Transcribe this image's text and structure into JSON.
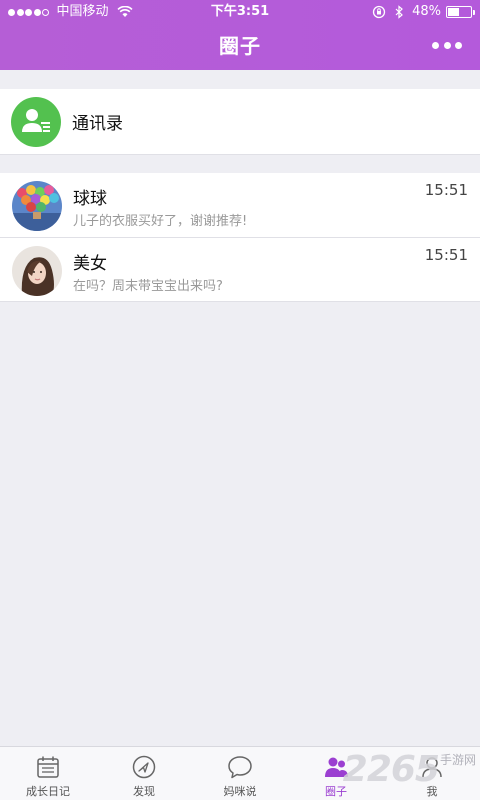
{
  "status_bar": {
    "carrier": "中国移动",
    "time": "下午3:51",
    "battery": "48%",
    "battery_level": 0.48
  },
  "nav": {
    "title": "圈子",
    "more_icon": "more-dots-icon"
  },
  "contacts": {
    "label": "通讯录",
    "icon": "contacts-icon",
    "icon_color": "#53c14f"
  },
  "chats": [
    {
      "name": "球球",
      "message": "儿子的衣服买好了，谢谢推荐!",
      "time": "15:51",
      "avatar": "balloons-avatar"
    },
    {
      "name": "美女",
      "message": "在吗？周末带宝宝出来吗?",
      "time": "15:51",
      "avatar": "woman-avatar"
    }
  ],
  "tabs": [
    {
      "label": "成长日记",
      "icon": "calendar-icon",
      "active": false
    },
    {
      "label": "发现",
      "icon": "compass-icon",
      "active": false
    },
    {
      "label": "妈咪说",
      "icon": "chat-bubble-icon",
      "active": false
    },
    {
      "label": "圈子",
      "icon": "people-icon",
      "active": true
    },
    {
      "label": "我",
      "icon": "user-icon",
      "active": false
    }
  ],
  "watermark": {
    "number": "2265",
    "text": "手游网"
  },
  "colors": {
    "accent": "#b45adb",
    "tab_active": "#9b3fd1",
    "background": "#eeeef3"
  }
}
